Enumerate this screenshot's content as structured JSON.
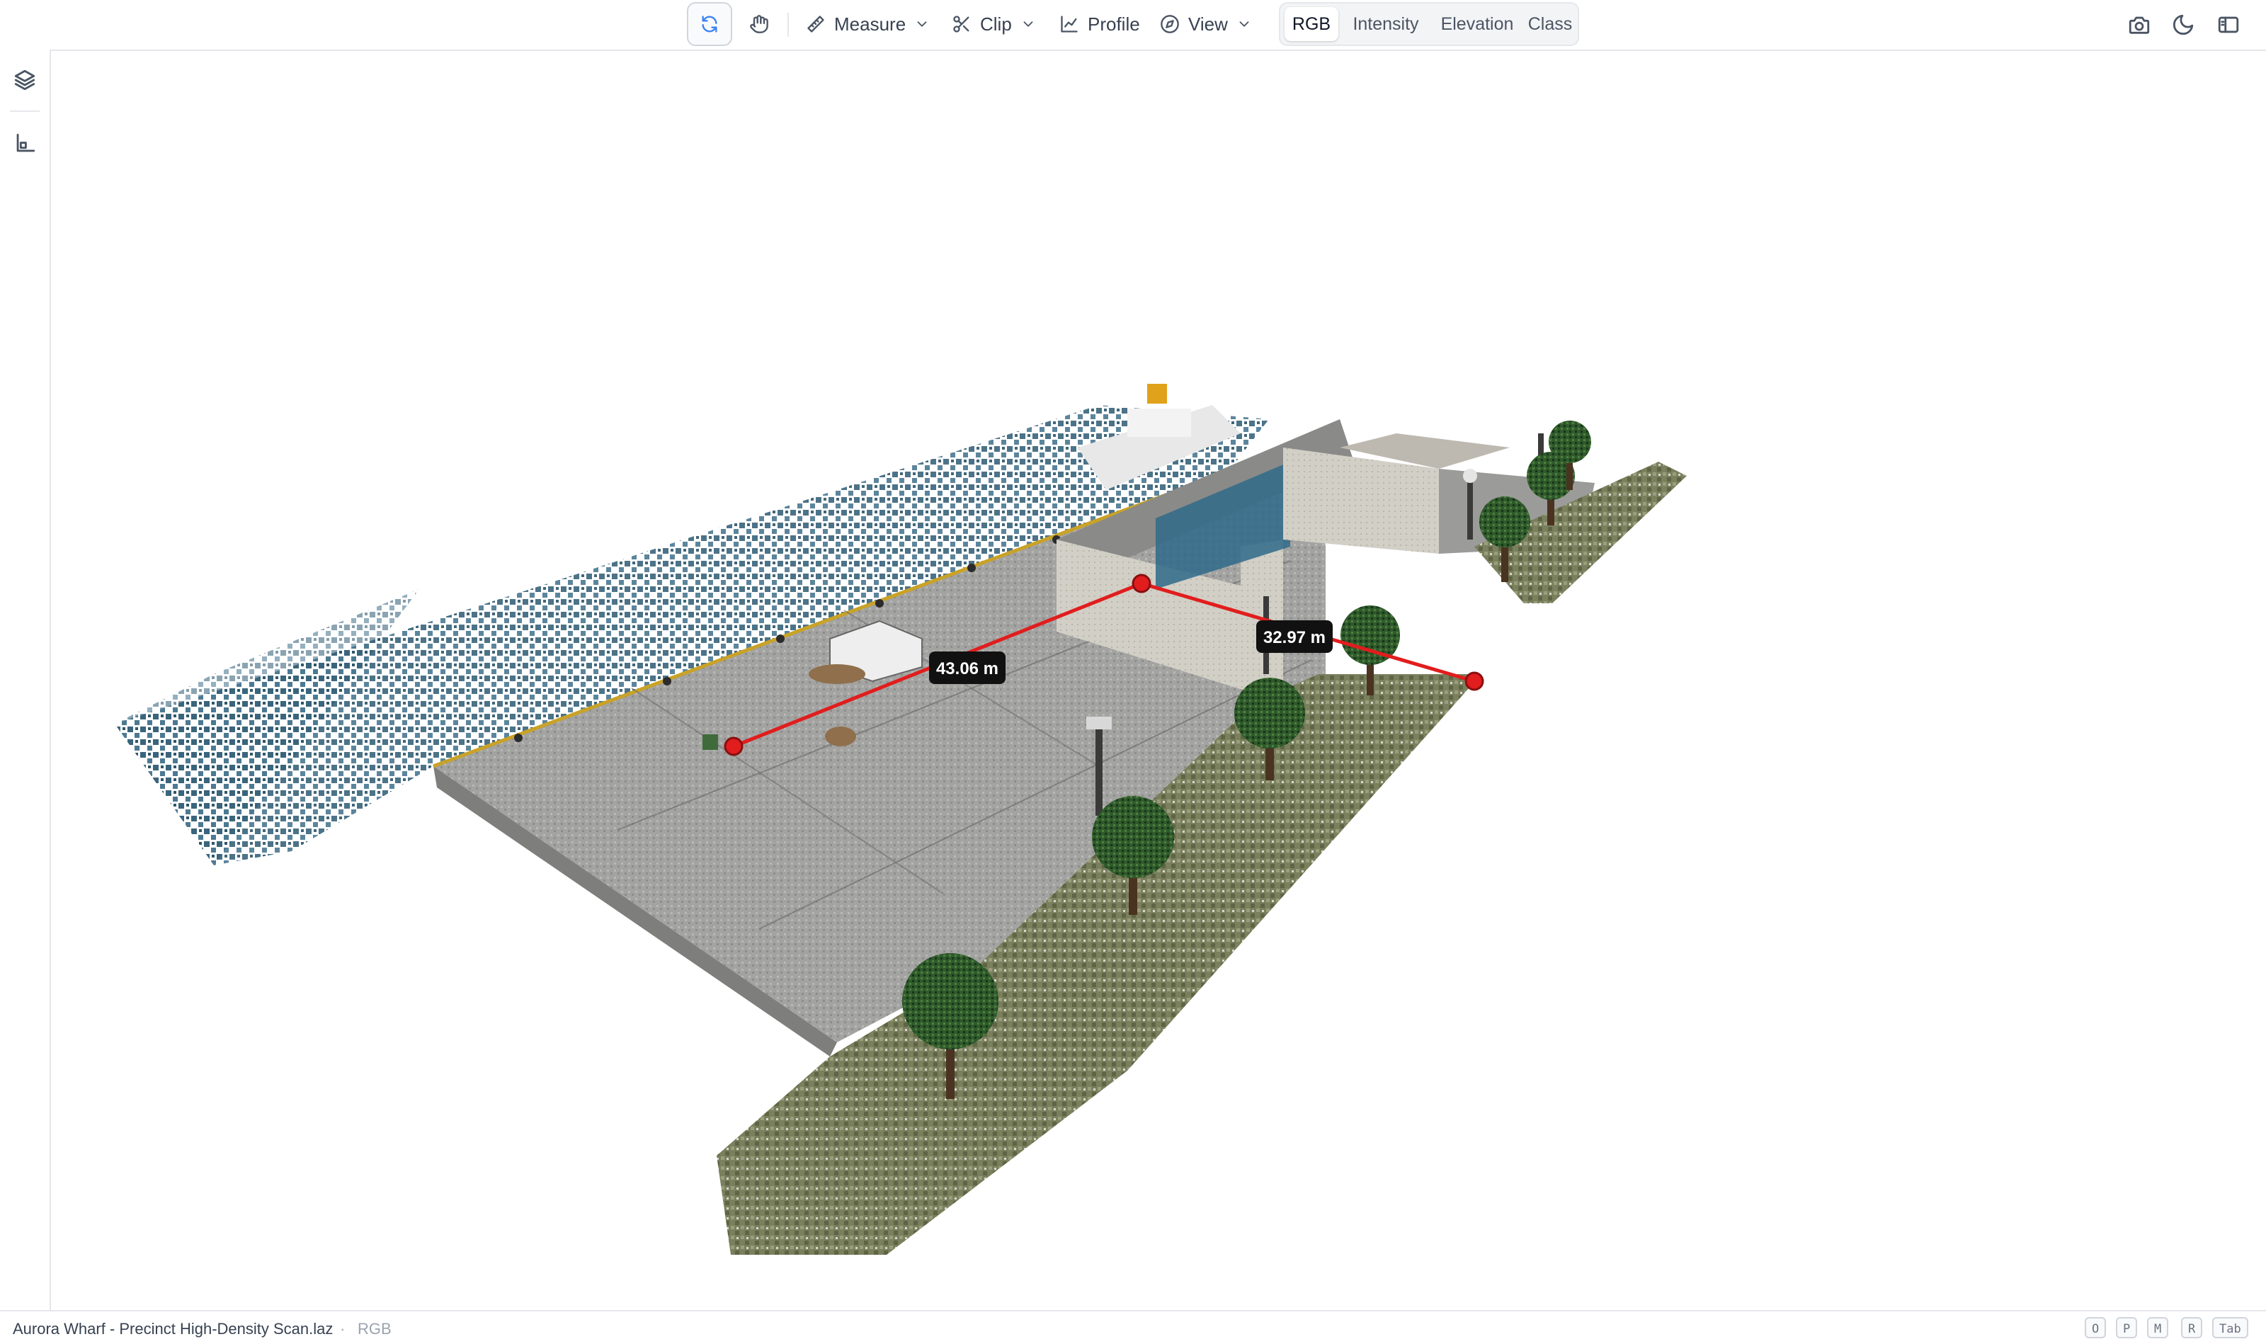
{
  "toolbar": {
    "orbit_tool": "orbit",
    "pan_tool": "pan",
    "measure_label": "Measure",
    "clip_label": "Clip",
    "profile_label": "Profile",
    "view_label": "View",
    "color_modes": [
      "RGB",
      "Intensity",
      "Elevation",
      "Class"
    ],
    "selected_color_mode": "RGB",
    "icons": [
      "refresh-icon",
      "hand-icon",
      "ruler-icon",
      "scissors-icon",
      "line-chart-icon",
      "compass-icon",
      "camera-icon",
      "moon-icon",
      "sidebar-icon"
    ]
  },
  "rail": {
    "icons": [
      "layers-icon",
      "axes-icon"
    ]
  },
  "viewport": {
    "measurements": [
      {
        "label": "43.06 m"
      },
      {
        "label": "32.97 m"
      }
    ],
    "measure_color": "#e11d1d",
    "water_color": "#2c5a73",
    "grass_color": "#6f7454",
    "pavement_color": "#9a9a98"
  },
  "statusbar": {
    "file_name": "Aurora Wharf - Precinct High-Density Scan.laz",
    "separator": "·",
    "color_mode": "RGB",
    "keys": [
      "O",
      "P",
      "M",
      "R",
      "Tab"
    ]
  }
}
